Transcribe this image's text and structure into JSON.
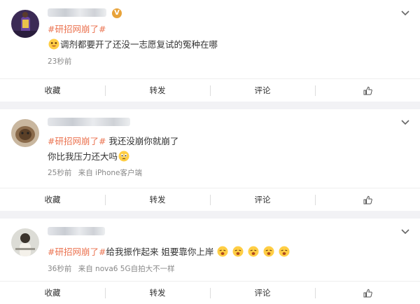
{
  "posts": [
    {
      "topic": "#研招网崩了#",
      "text": "调剂都要开了还没一志愿复试的冤种在哪",
      "line2": "",
      "time": "23秒前",
      "source": "",
      "verified_badge": "V"
    },
    {
      "topic": "#研招网崩了#",
      "text": " 我还没崩你就崩了",
      "line2": "你比我压力还大吗",
      "time": "25秒前",
      "source": "来自 iPhone客户端"
    },
    {
      "topic": "#研招网崩了#",
      "text": "给我振作起来 姐要靠你上岸",
      "line2": "",
      "time": "36秒前",
      "source": "来自 nova6 5G自拍大不一样"
    }
  ],
  "actions": {
    "collect": "收藏",
    "repost": "转发",
    "comment": "评论"
  },
  "colors": {
    "topic": "#eb7350",
    "badge": "#e8a33a",
    "emoji": "#ffce44"
  },
  "icons": [
    "chevron-down-icon",
    "thumbs-up-icon",
    "verified-badge-icon",
    "emoji-icon"
  ]
}
